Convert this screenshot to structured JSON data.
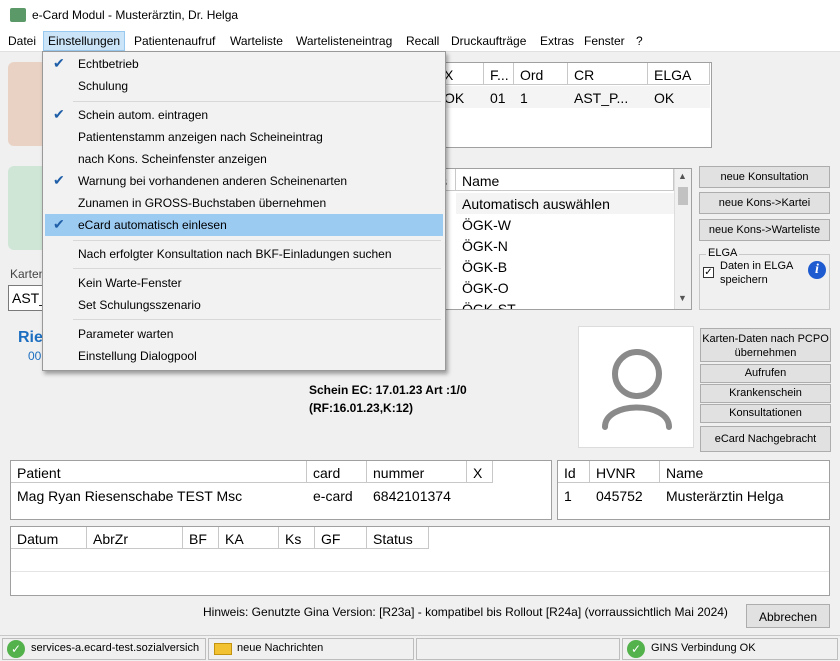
{
  "window": {
    "title": "e-Card Modul - Musterärztin, Dr. Helga"
  },
  "menu": [
    "Datei",
    "Einstellungen",
    "Patientenaufruf",
    "Warteliste",
    "Warteliste neintrag",
    "Recall",
    "Druckaufträge",
    "Extras",
    "Fenster",
    "?"
  ],
  "menu_labels": {
    "datei": "Datei",
    "einstellungen": "Einstellungen",
    "patientenaufruf": "Patientenaufruf",
    "warteliste": "Warteliste",
    "wartelisteneintrag": "Wartelisteneintrag",
    "recall": "Recall",
    "druckauftraege": "Druckaufträge",
    "extras": "Extras",
    "fenster": "Fenster",
    "help": "?"
  },
  "dropdown": {
    "items": [
      {
        "label": "Echtbetrieb",
        "checked": true
      },
      {
        "label": "Schulung",
        "checked": false
      },
      {
        "label": "Schein autom. eintragen",
        "checked": true
      },
      {
        "label": "Patientenstamm anzeigen nach Scheineintrag",
        "checked": false
      },
      {
        "label": "nach Kons. Scheinfenster anzeigen",
        "checked": false
      },
      {
        "label": "Warnung bei vorhandenen anderen Scheinenarten",
        "checked": true
      },
      {
        "label": "Zunamen in GROSS-Buchstaben übernehmen",
        "checked": false
      },
      {
        "label": "eCard automatisch einlesen",
        "checked": true,
        "selected": true
      },
      {
        "label": "Nach erfolgter Konsultation nach BKF-Einladungen suchen",
        "checked": false
      },
      {
        "label": "Kein Warte-Fenster",
        "checked": false
      },
      {
        "label": "Set Schulungsszenario",
        "checked": false
      },
      {
        "label": "Parameter warten",
        "checked": false
      },
      {
        "label": "Einstellung Dialogpool",
        "checked": false
      }
    ]
  },
  "top_grid": {
    "headers": [
      "X",
      "F...",
      "Ord",
      "CR",
      "ELGA"
    ],
    "row": [
      "OK",
      "01",
      "1",
      "AST_P...",
      "OK"
    ]
  },
  "kasse_grid": {
    "header_left": "s",
    "header": "Name",
    "rows": [
      "Automatisch auswählen",
      "ÖGK-W",
      "ÖGK-N",
      "ÖGK-B",
      "ÖGK-O",
      "ÖGK-ST"
    ]
  },
  "left": {
    "karte_label": "Karten",
    "karte_value": "AST_",
    "patient_name_partial": "Rie",
    "patient_num_partial": "00"
  },
  "buttons": {
    "neue_konsultation": "neue Konsultation",
    "neue_kons_kartei": "neue Kons->Kartei",
    "neue_kons_warteliste": "neue Kons->Warteliste",
    "karten_daten": "Karten-Daten nach PCPO übernehmen",
    "aufrufen": "Aufrufen",
    "krankenschein": "Krankenschein",
    "konsultationen": "Konsultationen",
    "ecard_nachgebracht": "eCard Nachgebracht",
    "abbrechen": "Abbrechen"
  },
  "elga": {
    "group": "ELGA",
    "checkbox_label": "Daten in ELGA speichern",
    "checked": true
  },
  "schein": {
    "line1": "Schein EC: 17.01.23  Art :1/0",
    "line2": "(RF:16.01.23,K:12)"
  },
  "patient_grid": {
    "headers": [
      "Patient",
      "card",
      "nummer",
      "X"
    ],
    "row": [
      "Mag Ryan Riesenschabe TEST Msc",
      "e-card",
      "6842101374",
      ""
    ]
  },
  "arzt_grid": {
    "headers": [
      "Id",
      "HVNR",
      "Name"
    ],
    "row": [
      "1",
      "045752",
      "Musterärztin Helga"
    ]
  },
  "history_grid": {
    "headers": [
      "Datum",
      "AbrZr",
      "BF",
      "KA",
      "Ks",
      "GF",
      "Status"
    ]
  },
  "hint": "Hinweis: Genutzte Gina Version: [R23a] - kompatibel bis Rollout [R24a] (vorraussichtlich Mai 2024)",
  "status": {
    "server": "services-a.ecard-test.sozialversich",
    "messages": "neue Nachrichten",
    "gins": "GINS Verbindung OK"
  }
}
